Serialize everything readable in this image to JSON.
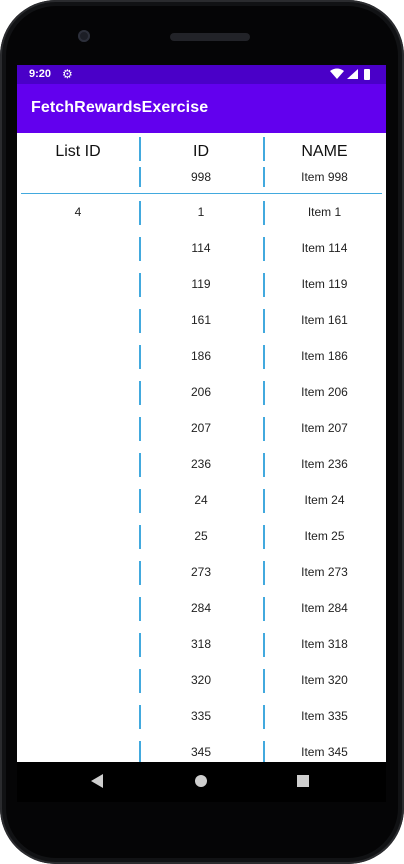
{
  "status_bar": {
    "time": "9:20",
    "icons": [
      "gear-icon",
      "wifi-icon",
      "signal-icon",
      "battery-icon"
    ]
  },
  "app_bar": {
    "title": "FetchRewardsExercise"
  },
  "table": {
    "headers": [
      "List ID",
      "ID",
      "NAME"
    ],
    "partial_row": {
      "id": "998",
      "name": "Item 998"
    },
    "rows": [
      {
        "list_id": "4",
        "id": "1",
        "name": "Item 1"
      },
      {
        "list_id": "",
        "id": "114",
        "name": "Item 114"
      },
      {
        "list_id": "",
        "id": "119",
        "name": "Item 119"
      },
      {
        "list_id": "",
        "id": "161",
        "name": "Item 161"
      },
      {
        "list_id": "",
        "id": "186",
        "name": "Item 186"
      },
      {
        "list_id": "",
        "id": "206",
        "name": "Item 206"
      },
      {
        "list_id": "",
        "id": "207",
        "name": "Item 207"
      },
      {
        "list_id": "",
        "id": "236",
        "name": "Item 236"
      },
      {
        "list_id": "",
        "id": "24",
        "name": "Item 24"
      },
      {
        "list_id": "",
        "id": "25",
        "name": "Item 25"
      },
      {
        "list_id": "",
        "id": "273",
        "name": "Item 273"
      },
      {
        "list_id": "",
        "id": "284",
        "name": "Item 284"
      },
      {
        "list_id": "",
        "id": "318",
        "name": "Item 318"
      },
      {
        "list_id": "",
        "id": "320",
        "name": "Item 320"
      },
      {
        "list_id": "",
        "id": "335",
        "name": "Item 335"
      },
      {
        "list_id": "",
        "id": "345",
        "name": "Item 345"
      }
    ]
  },
  "navigation_bar": {
    "buttons": [
      "back-icon",
      "home-icon",
      "recents-icon"
    ]
  },
  "colors": {
    "status_bar": "#4a00c8",
    "app_bar": "#6200ee",
    "divider": "#42a9de",
    "nav_bar": "#000000"
  }
}
